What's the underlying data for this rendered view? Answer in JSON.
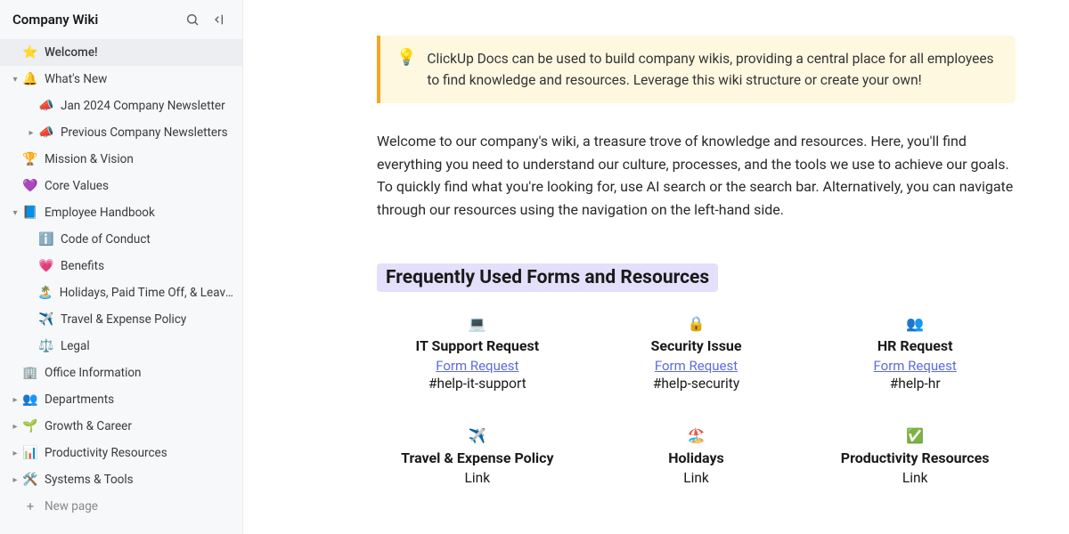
{
  "workspace_title": "Company Wiki",
  "sidebar": {
    "items": [
      {
        "depth": 0,
        "chev": "",
        "emoji": "⭐",
        "label": "Welcome!",
        "active": true
      },
      {
        "depth": 0,
        "chev": "▾",
        "emoji": "🔔",
        "label": "What's New"
      },
      {
        "depth": 1,
        "chev": "",
        "emoji": "📣",
        "label": "Jan 2024 Company Newsletter"
      },
      {
        "depth": 1,
        "chev": "▸",
        "emoji": "📣",
        "label": "Previous Company Newsletters"
      },
      {
        "depth": 0,
        "chev": "",
        "emoji": "🏆",
        "label": "Mission & Vision"
      },
      {
        "depth": 0,
        "chev": "",
        "emoji": "💜",
        "label": "Core Values"
      },
      {
        "depth": 0,
        "chev": "▾",
        "emoji": "📘",
        "label": "Employee Handbook"
      },
      {
        "depth": 1,
        "chev": "",
        "emoji": "ℹ️",
        "label": "Code of Conduct"
      },
      {
        "depth": 1,
        "chev": "",
        "emoji": "💗",
        "label": "Benefits"
      },
      {
        "depth": 1,
        "chev": "",
        "emoji": "🏝️",
        "label": "Holidays, Paid Time Off, & Leave…"
      },
      {
        "depth": 1,
        "chev": "",
        "emoji": "✈️",
        "label": "Travel & Expense Policy"
      },
      {
        "depth": 1,
        "chev": "",
        "emoji": "⚖️",
        "label": "Legal"
      },
      {
        "depth": 0,
        "chev": "",
        "emoji": "🏢",
        "label": "Office Information"
      },
      {
        "depth": 0,
        "chev": "▸",
        "emoji": "👥",
        "label": "Departments"
      },
      {
        "depth": 0,
        "chev": "▸",
        "emoji": "🌱",
        "label": "Growth & Career"
      },
      {
        "depth": 0,
        "chev": "▸",
        "emoji": "📊",
        "label": "Productivity Resources"
      },
      {
        "depth": 0,
        "chev": "▸",
        "emoji": "🛠️",
        "label": "Systems & Tools"
      }
    ],
    "new_page_label": "New page"
  },
  "callout": {
    "icon": "💡",
    "text": "ClickUp Docs can be used to build company wikis, providing a central place for all employees to find knowledge and resources. Leverage this wiki structure or create your own!"
  },
  "intro_text": "Welcome to our company's wiki, a treasure trove of knowledge and resources. Here, you'll find everything you need to understand our culture, processes, and the tools we use to achieve our goals. To quickly find what you're looking for, use AI search or the search bar. Alternatively, you can navigate through our resources using the navigation on the left-hand side.",
  "section_heading": "Frequently Used Forms and Resources",
  "cards": [
    {
      "icon": "💻",
      "title": "IT Support Request",
      "link_label": "Form Request",
      "link_type": "link",
      "tag": "#help-it-support"
    },
    {
      "icon": "🔒",
      "title": "Security Issue",
      "link_label": "Form Request",
      "link_type": "link",
      "tag": "#help-security"
    },
    {
      "icon": "👥",
      "title": "HR Request",
      "link_label": "Form Request",
      "link_type": "link",
      "tag": "#help-hr"
    },
    {
      "icon": "✈️",
      "title": "Travel & Expense Policy",
      "link_label": "Link",
      "link_type": "plain",
      "tag": ""
    },
    {
      "icon": "🏖️",
      "title": "Holidays",
      "link_label": "Link",
      "link_type": "plain",
      "tag": ""
    },
    {
      "icon": "✅",
      "title": "Productivity Resources",
      "link_label": "Link",
      "link_type": "plain",
      "tag": ""
    }
  ]
}
